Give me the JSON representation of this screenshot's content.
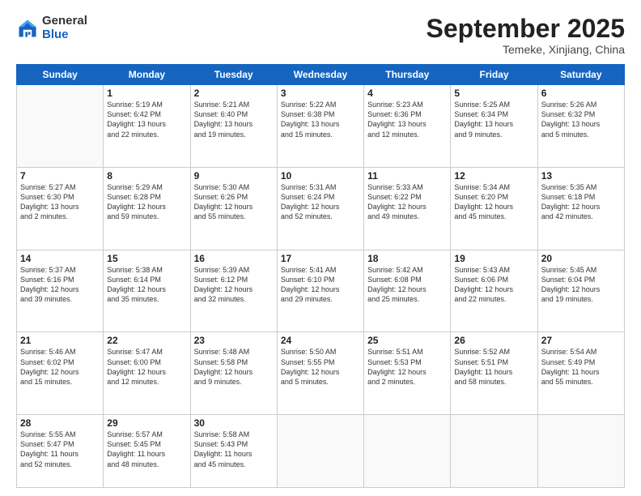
{
  "logo": {
    "general": "General",
    "blue": "Blue"
  },
  "header": {
    "month": "September 2025",
    "location": "Temeke, Xinjiang, China"
  },
  "days_of_week": [
    "Sunday",
    "Monday",
    "Tuesday",
    "Wednesday",
    "Thursday",
    "Friday",
    "Saturday"
  ],
  "weeks": [
    [
      {
        "day": "",
        "info": ""
      },
      {
        "day": "1",
        "info": "Sunrise: 5:19 AM\nSunset: 6:42 PM\nDaylight: 13 hours\nand 22 minutes."
      },
      {
        "day": "2",
        "info": "Sunrise: 5:21 AM\nSunset: 6:40 PM\nDaylight: 13 hours\nand 19 minutes."
      },
      {
        "day": "3",
        "info": "Sunrise: 5:22 AM\nSunset: 6:38 PM\nDaylight: 13 hours\nand 15 minutes."
      },
      {
        "day": "4",
        "info": "Sunrise: 5:23 AM\nSunset: 6:36 PM\nDaylight: 13 hours\nand 12 minutes."
      },
      {
        "day": "5",
        "info": "Sunrise: 5:25 AM\nSunset: 6:34 PM\nDaylight: 13 hours\nand 9 minutes."
      },
      {
        "day": "6",
        "info": "Sunrise: 5:26 AM\nSunset: 6:32 PM\nDaylight: 13 hours\nand 5 minutes."
      }
    ],
    [
      {
        "day": "7",
        "info": "Sunrise: 5:27 AM\nSunset: 6:30 PM\nDaylight: 13 hours\nand 2 minutes."
      },
      {
        "day": "8",
        "info": "Sunrise: 5:29 AM\nSunset: 6:28 PM\nDaylight: 12 hours\nand 59 minutes."
      },
      {
        "day": "9",
        "info": "Sunrise: 5:30 AM\nSunset: 6:26 PM\nDaylight: 12 hours\nand 55 minutes."
      },
      {
        "day": "10",
        "info": "Sunrise: 5:31 AM\nSunset: 6:24 PM\nDaylight: 12 hours\nand 52 minutes."
      },
      {
        "day": "11",
        "info": "Sunrise: 5:33 AM\nSunset: 6:22 PM\nDaylight: 12 hours\nand 49 minutes."
      },
      {
        "day": "12",
        "info": "Sunrise: 5:34 AM\nSunset: 6:20 PM\nDaylight: 12 hours\nand 45 minutes."
      },
      {
        "day": "13",
        "info": "Sunrise: 5:35 AM\nSunset: 6:18 PM\nDaylight: 12 hours\nand 42 minutes."
      }
    ],
    [
      {
        "day": "14",
        "info": "Sunrise: 5:37 AM\nSunset: 6:16 PM\nDaylight: 12 hours\nand 39 minutes."
      },
      {
        "day": "15",
        "info": "Sunrise: 5:38 AM\nSunset: 6:14 PM\nDaylight: 12 hours\nand 35 minutes."
      },
      {
        "day": "16",
        "info": "Sunrise: 5:39 AM\nSunset: 6:12 PM\nDaylight: 12 hours\nand 32 minutes."
      },
      {
        "day": "17",
        "info": "Sunrise: 5:41 AM\nSunset: 6:10 PM\nDaylight: 12 hours\nand 29 minutes."
      },
      {
        "day": "18",
        "info": "Sunrise: 5:42 AM\nSunset: 6:08 PM\nDaylight: 12 hours\nand 25 minutes."
      },
      {
        "day": "19",
        "info": "Sunrise: 5:43 AM\nSunset: 6:06 PM\nDaylight: 12 hours\nand 22 minutes."
      },
      {
        "day": "20",
        "info": "Sunrise: 5:45 AM\nSunset: 6:04 PM\nDaylight: 12 hours\nand 19 minutes."
      }
    ],
    [
      {
        "day": "21",
        "info": "Sunrise: 5:46 AM\nSunset: 6:02 PM\nDaylight: 12 hours\nand 15 minutes."
      },
      {
        "day": "22",
        "info": "Sunrise: 5:47 AM\nSunset: 6:00 PM\nDaylight: 12 hours\nand 12 minutes."
      },
      {
        "day": "23",
        "info": "Sunrise: 5:48 AM\nSunset: 5:58 PM\nDaylight: 12 hours\nand 9 minutes."
      },
      {
        "day": "24",
        "info": "Sunrise: 5:50 AM\nSunset: 5:55 PM\nDaylight: 12 hours\nand 5 minutes."
      },
      {
        "day": "25",
        "info": "Sunrise: 5:51 AM\nSunset: 5:53 PM\nDaylight: 12 hours\nand 2 minutes."
      },
      {
        "day": "26",
        "info": "Sunrise: 5:52 AM\nSunset: 5:51 PM\nDaylight: 11 hours\nand 58 minutes."
      },
      {
        "day": "27",
        "info": "Sunrise: 5:54 AM\nSunset: 5:49 PM\nDaylight: 11 hours\nand 55 minutes."
      }
    ],
    [
      {
        "day": "28",
        "info": "Sunrise: 5:55 AM\nSunset: 5:47 PM\nDaylight: 11 hours\nand 52 minutes."
      },
      {
        "day": "29",
        "info": "Sunrise: 5:57 AM\nSunset: 5:45 PM\nDaylight: 11 hours\nand 48 minutes."
      },
      {
        "day": "30",
        "info": "Sunrise: 5:58 AM\nSunset: 5:43 PM\nDaylight: 11 hours\nand 45 minutes."
      },
      {
        "day": "",
        "info": ""
      },
      {
        "day": "",
        "info": ""
      },
      {
        "day": "",
        "info": ""
      },
      {
        "day": "",
        "info": ""
      }
    ]
  ]
}
